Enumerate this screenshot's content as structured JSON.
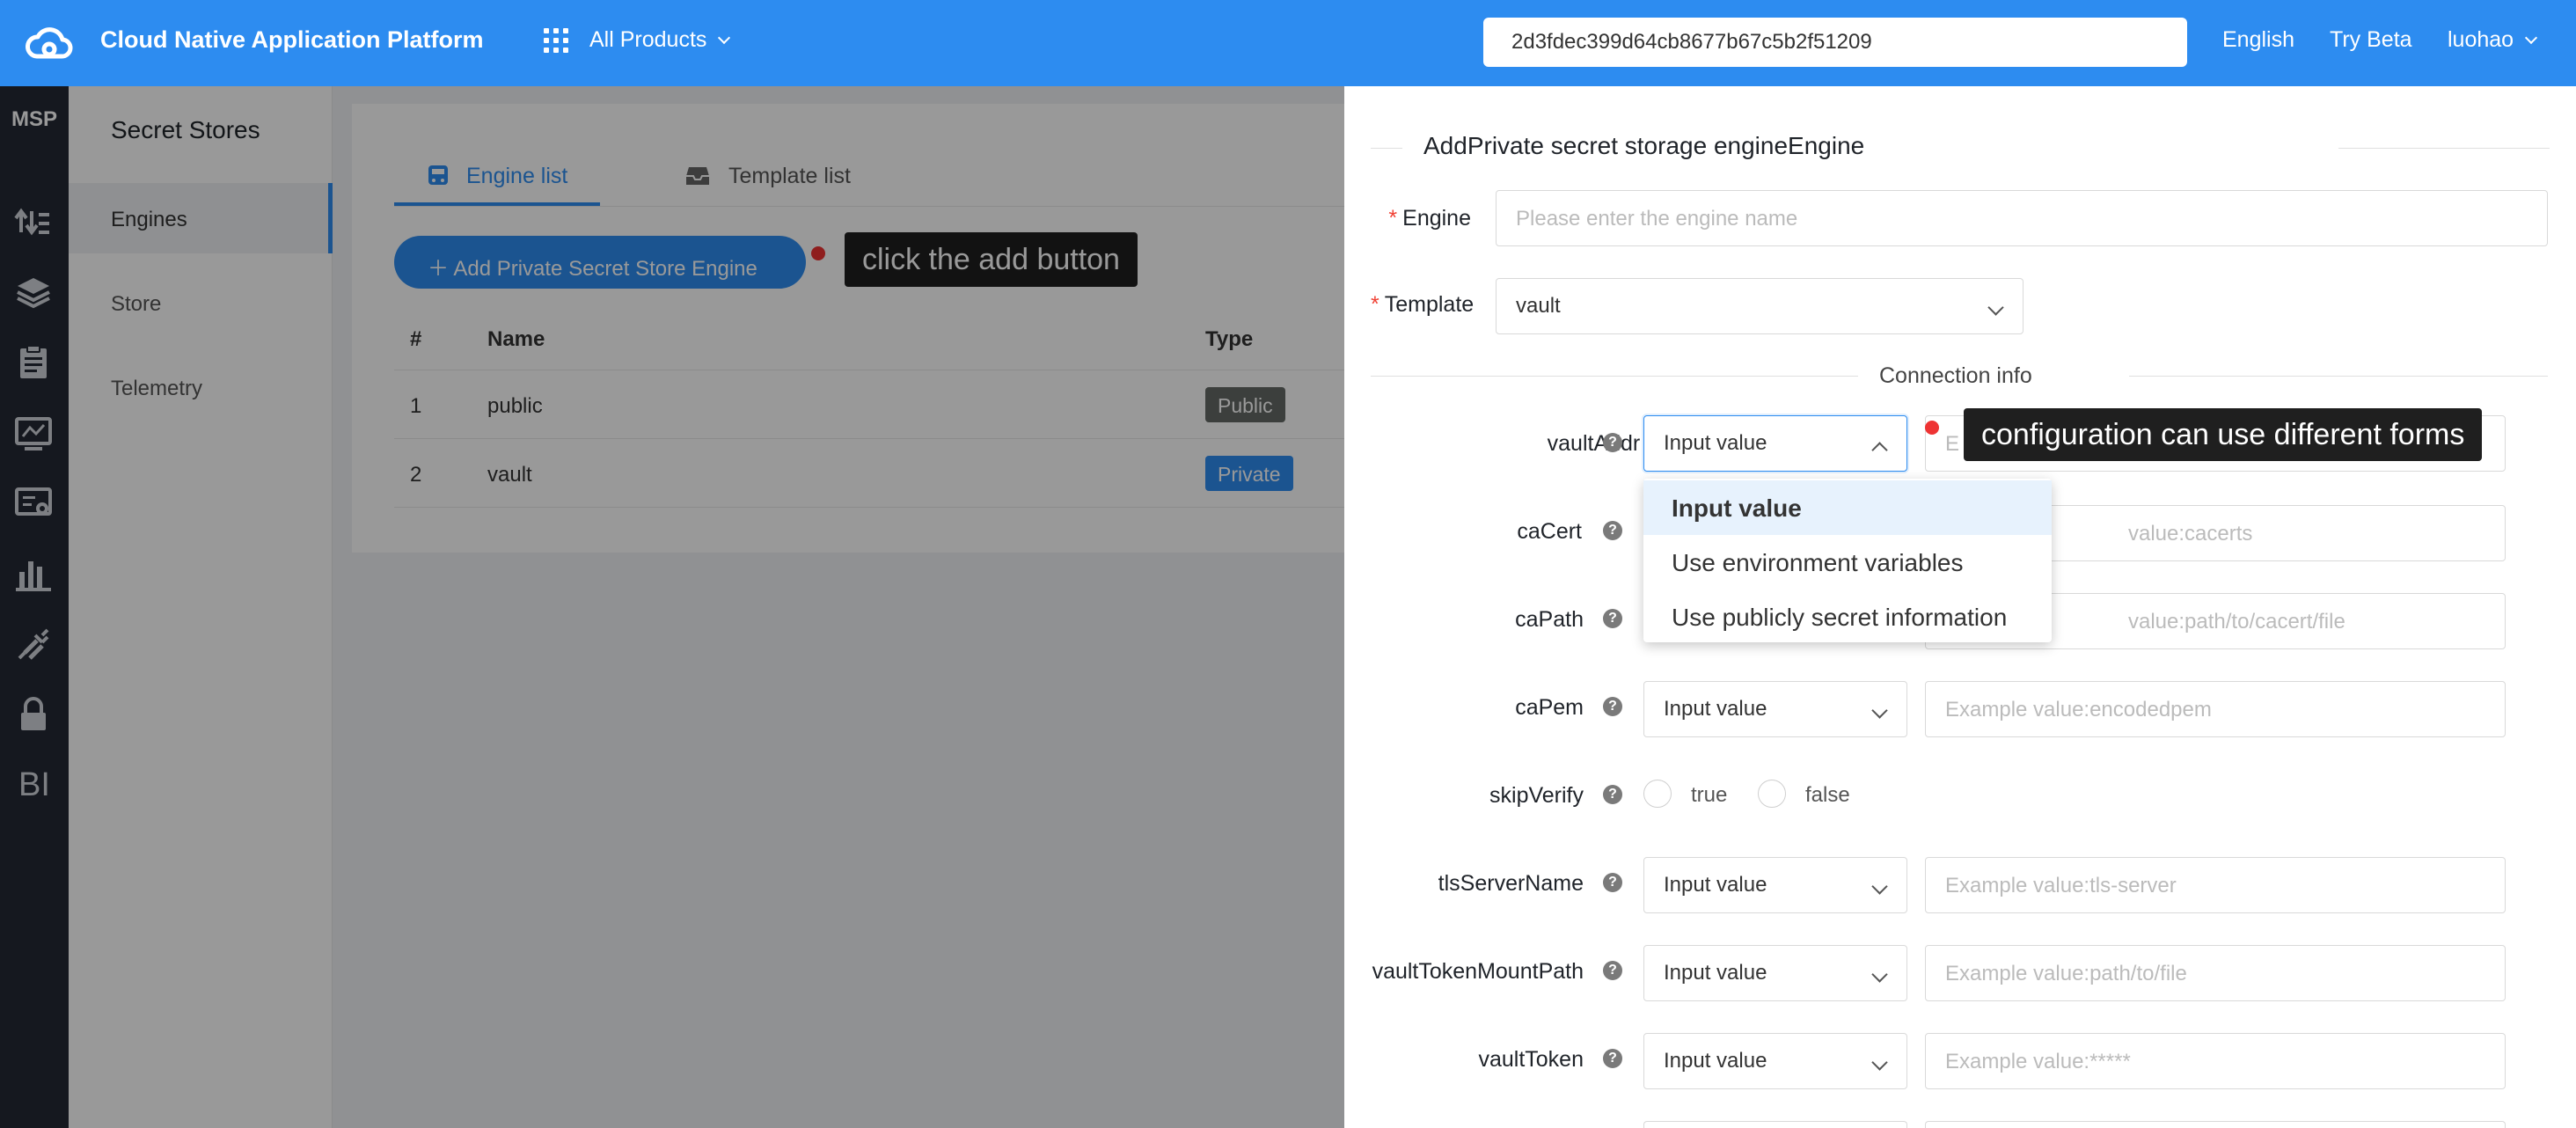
{
  "topbar": {
    "title": "Cloud Native Application Platform",
    "products": "All Products",
    "search_value": "2d3fdec399d64cb8677b67c5b2f51209",
    "language": "English",
    "try_beta": "Try Beta",
    "user": "luohao",
    "bg_color": "#2d8cf0"
  },
  "rail": {
    "label": "MSP",
    "icons": [
      "sort-icon",
      "layers-icon",
      "clipboard-icon",
      "monitor-icon",
      "settings-screen-icon",
      "bar-chart-icon",
      "plug-icon",
      "lock-icon",
      "bi-icon"
    ],
    "bi_text": "BI"
  },
  "sidebar": {
    "heading": "Secret Stores",
    "items": [
      {
        "label": "Engines",
        "active": true
      },
      {
        "label": "Store"
      },
      {
        "label": "Telemetry"
      }
    ]
  },
  "main": {
    "tabs": [
      {
        "label": "Engine list",
        "icon": "engine-icon",
        "active": true
      },
      {
        "label": "Template list",
        "icon": "inbox-icon"
      }
    ],
    "add_button": "＋  Add Private Secret Store Engine",
    "tooltip": "click the add button",
    "table": {
      "headers": [
        "#",
        "Name",
        "Type"
      ],
      "rows": [
        {
          "index": "1",
          "name": "public",
          "type": "Public",
          "type_color": "#646a66"
        },
        {
          "index": "2",
          "name": "vault",
          "type": "Private",
          "type_color": "#2d8cf0"
        }
      ]
    }
  },
  "drawer": {
    "title": "AddPrivate secret storage engineEngine",
    "engine_label": "Engine",
    "engine_placeholder": "Please enter the engine name",
    "template_label": "Template",
    "template_value": "vault",
    "connection_title": "Connection info",
    "tooltip": "configuration can use different forms",
    "fields": [
      {
        "name": "vaultAddr",
        "required": true,
        "mode": "Input value",
        "placeholder": "E"
      },
      {
        "name": "caCert",
        "mode": "Input value",
        "placeholder": "Example value:cacerts"
      },
      {
        "name": "caPath",
        "mode": "Input value",
        "placeholder": "Example value:path/to/cacert/file"
      },
      {
        "name": "caPem",
        "mode": "Input value",
        "placeholder": "Example value:encodedpem"
      },
      {
        "name": "skipVerify",
        "radio": [
          "true",
          "false"
        ]
      },
      {
        "name": "tlsServerName",
        "mode": "Input value",
        "placeholder": "Example value:tls-server"
      },
      {
        "name": "vaultTokenMountPath",
        "mode": "Input value",
        "placeholder": "Example value:path/to/file"
      },
      {
        "name": "vaultToken",
        "mode": "Input value",
        "placeholder": "Example value:*****"
      }
    ],
    "dropdown_options": [
      "Input value",
      "Use environment variables",
      "Use publicly secret information"
    ],
    "caCert_visible": "value:cacerts",
    "caPath_visible": "value:path/to/cacert/file"
  }
}
